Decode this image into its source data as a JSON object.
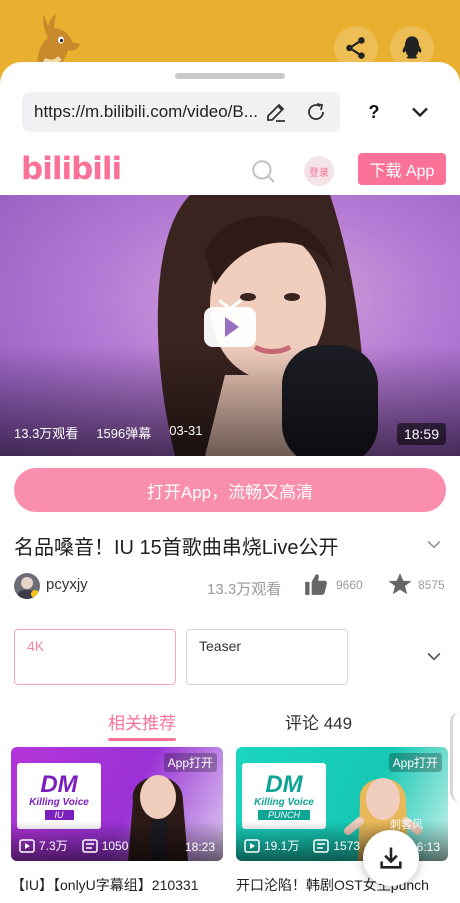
{
  "browser": {
    "url": "https://m.bilibili.com/video/B...",
    "help_label": "?"
  },
  "site": {
    "logo": "bilibili",
    "login_label": "登录",
    "download_app_label": "下载 App"
  },
  "video": {
    "views": "13.3万观看",
    "danmaku": "1596弹幕",
    "date": "03-31",
    "duration": "18:59",
    "title": "名品嗓音！IU 15首歌曲串烧Live公开"
  },
  "open_app_label": "打开App，流畅又高清",
  "author": {
    "name": "pcyxjy",
    "views": "13.3万观看",
    "likes": "9660",
    "favorites": "8575"
  },
  "parts": [
    {
      "label": "4K"
    },
    {
      "label": "Teaser"
    }
  ],
  "tabs": {
    "related": "相关推荐",
    "comments": "评论 449"
  },
  "cards": [
    {
      "logo_big": "DM",
      "logo_sub": "Killing Voice",
      "logo_tag": "IU",
      "app_tag": "App打开",
      "views": "7.3万",
      "danmaku": "1050",
      "duration": "18:23",
      "title": "【IU】【onlyU字幕组】210331"
    },
    {
      "logo_big": "DM",
      "logo_sub": "Killing Voice",
      "logo_tag": "PUNCH",
      "app_tag": "App打开",
      "views": "19.1万",
      "danmaku": "1573",
      "duration": "16:13",
      "title": "开口沦陷！韩剧OST女王punch"
    }
  ],
  "watermark": "刺客风"
}
